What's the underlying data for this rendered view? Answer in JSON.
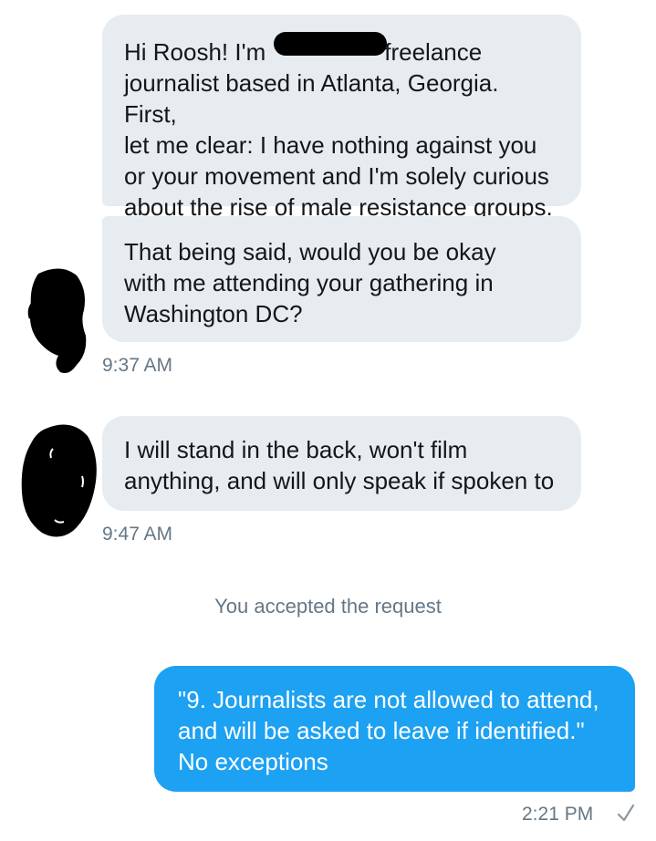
{
  "thread": {
    "messages": [
      {
        "direction": "received",
        "lines": [
          "Hi Roosh! I'm",
          "journalist based in Atlanta, Georgia. First,",
          "let me clear: I have nothing against you",
          "or your movement and I'm solely curious",
          "about the rise of male resistance groups."
        ],
        "line1_tail": "freelance"
      },
      {
        "direction": "received",
        "lines": [
          "That being said, would you be okay",
          "with me attending your gathering in",
          "Washington DC?"
        ],
        "time": "9:37 AM"
      },
      {
        "direction": "received",
        "lines": [
          "I will stand in the back, won't film",
          "anything, and will only speak if spoken to"
        ],
        "time": "9:47 AM"
      }
    ],
    "system_notice": "You accepted the request",
    "sent": {
      "lines": [
        "\"9. Journalists are not allowed to attend,",
        "and will be asked to leave if identified.\"",
        "No exceptions"
      ],
      "time": "2:21 PM",
      "status_icon": "checkmark-icon"
    }
  },
  "colors": {
    "received_bubble": "#e6ecf0",
    "sent_bubble": "#1da1f2",
    "meta_text": "#657786",
    "avatar_redaction": "#000000"
  }
}
